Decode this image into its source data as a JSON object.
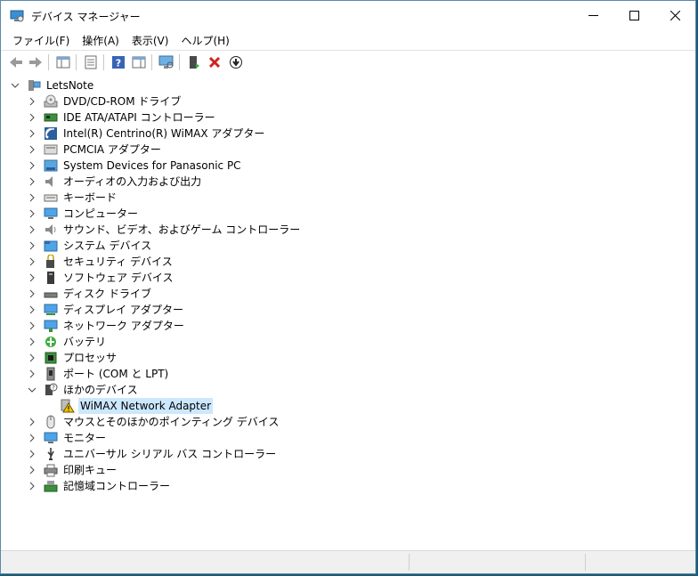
{
  "window": {
    "title": "デバイス マネージャー"
  },
  "menu": [
    {
      "name": "menu-file",
      "label": "ファイル(F)"
    },
    {
      "name": "menu-action",
      "label": "操作(A)"
    },
    {
      "name": "menu-view",
      "label": "表示(V)"
    },
    {
      "name": "menu-help",
      "label": "ヘルプ(H)"
    }
  ],
  "toolbar": {
    "buttons": [
      "back-icon",
      "forward-icon",
      "show-hide-console-tree-icon",
      "properties-icon",
      "help-icon",
      "show-action-pane-icon",
      "scan-hardware-icon",
      "enable-device-icon",
      "uninstall-device-icon",
      "update-driver-icon"
    ]
  },
  "tree": {
    "root": "LetsNote",
    "categories": [
      {
        "label": "DVD/CD-ROM ドライブ",
        "icon": "dvd-drive-icon",
        "expanded": false
      },
      {
        "label": "IDE ATA/ATAPI コントローラー",
        "icon": "ide-controller-icon",
        "expanded": false
      },
      {
        "label": "Intel(R) Centrino(R) WiMAX アダプター",
        "icon": "wimax-adapter-icon",
        "expanded": false
      },
      {
        "label": "PCMCIA アダプター",
        "icon": "pcmcia-adapter-icon",
        "expanded": false
      },
      {
        "label": "System Devices for Panasonic PC",
        "icon": "system-devices-icon",
        "expanded": false
      },
      {
        "label": "オーディオの入力および出力",
        "icon": "audio-icon",
        "expanded": false
      },
      {
        "label": "キーボード",
        "icon": "keyboard-icon",
        "expanded": false
      },
      {
        "label": "コンピューター",
        "icon": "computer-icon",
        "expanded": false
      },
      {
        "label": "サウンド、ビデオ、およびゲーム コントローラー",
        "icon": "sound-controller-icon",
        "expanded": false
      },
      {
        "label": "システム デバイス",
        "icon": "system-device-folder-icon",
        "expanded": false
      },
      {
        "label": "セキュリティ デバイス",
        "icon": "security-device-icon",
        "expanded": false
      },
      {
        "label": "ソフトウェア デバイス",
        "icon": "software-device-icon",
        "expanded": false
      },
      {
        "label": "ディスク ドライブ",
        "icon": "disk-drive-icon",
        "expanded": false
      },
      {
        "label": "ディスプレイ アダプター",
        "icon": "display-adapter-icon",
        "expanded": false
      },
      {
        "label": "ネットワーク アダプター",
        "icon": "network-adapter-icon",
        "expanded": false
      },
      {
        "label": "バッテリ",
        "icon": "battery-icon",
        "expanded": false
      },
      {
        "label": "プロセッサ",
        "icon": "processor-icon",
        "expanded": false
      },
      {
        "label": "ポート (COM と LPT)",
        "icon": "port-icon",
        "expanded": false
      },
      {
        "label": "ほかのデバイス",
        "icon": "other-devices-icon",
        "expanded": true,
        "children": [
          {
            "label": "WiMAX Network Adapter",
            "icon": "warning-device-icon",
            "selected": true
          }
        ]
      },
      {
        "label": "マウスとそのほかのポインティング デバイス",
        "icon": "mouse-icon",
        "expanded": false
      },
      {
        "label": "モニター",
        "icon": "monitor-icon",
        "expanded": false
      },
      {
        "label": "ユニバーサル シリアル バス コントローラー",
        "icon": "usb-controller-icon",
        "expanded": false
      },
      {
        "label": "印刷キュー",
        "icon": "print-queue-icon",
        "expanded": false
      },
      {
        "label": "記憶域コントローラー",
        "icon": "storage-controller-icon",
        "expanded": false
      }
    ]
  },
  "colors": {
    "selection": "#cce8ff",
    "desktop": "#1d5a78",
    "warning": "#f5c400"
  }
}
